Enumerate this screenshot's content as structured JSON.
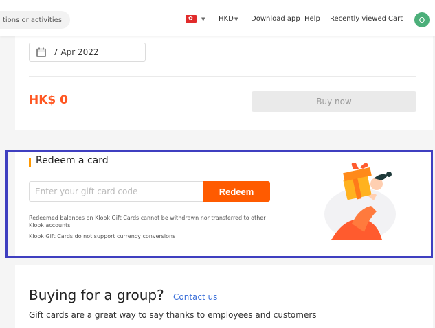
{
  "header": {
    "search_placeholder": "tions or activities",
    "currency": "HKD",
    "nav": [
      "Download app",
      "Help",
      "Recently viewed",
      "Cart"
    ],
    "avatar_letter": "O",
    "flag_star": "✿"
  },
  "booking": {
    "date": "7 Apr 2022",
    "price": "HK$ 0",
    "buy_label": "Buy now"
  },
  "redeem": {
    "title": "Redeem a card",
    "input_placeholder": "Enter your gift card code",
    "button_label": "Redeem",
    "notes": [
      "Redeemed balances on Klook Gift Cards cannot be withdrawn nor transferred to other Klook accounts",
      "Klook Gift Cards do not support currency conversions"
    ]
  },
  "group": {
    "title": "Buying for a group?",
    "contact_label": "Contact us",
    "subtitle": "Gift cards are a great way to say thanks to employees and customers"
  },
  "colors": {
    "accent": "#ff5b00",
    "highlight": "#3f3fc0",
    "price": "#ff5722"
  }
}
